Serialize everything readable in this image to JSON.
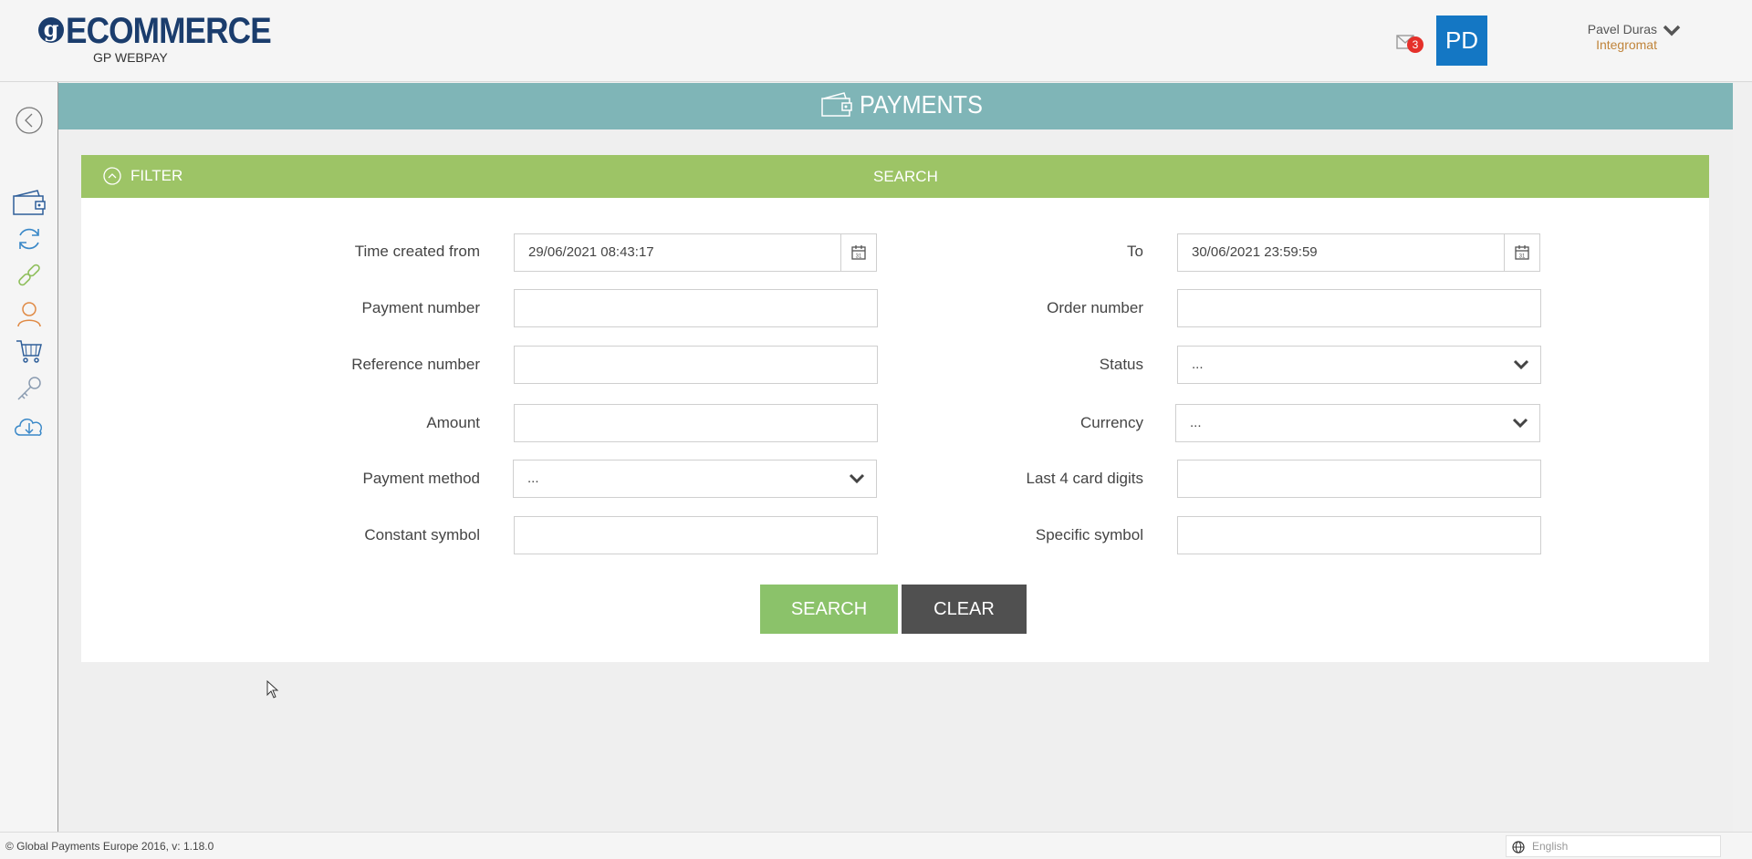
{
  "header": {
    "logo_letter": "g",
    "logo_title": "ECOMMERCE",
    "logo_subtitle": "GP WEBPAY",
    "messages_count": "3",
    "avatar_initials": "PD",
    "user_name": "Pavel Duras",
    "user_org": "Integromat"
  },
  "page": {
    "title": "PAYMENTS"
  },
  "filter": {
    "toggle_label": "FILTER",
    "center_label": "SEARCH"
  },
  "form": {
    "time_from_label": "Time created from",
    "time_from_value": "29/06/2021 08:43:17",
    "to_label": "To",
    "to_value": "30/06/2021 23:59:59",
    "payment_number_label": "Payment number",
    "order_number_label": "Order number",
    "reference_number_label": "Reference number",
    "status_label": "Status",
    "status_value": "...",
    "amount_label": "Amount",
    "currency_label": "Currency",
    "currency_value": "...",
    "payment_method_label": "Payment method",
    "payment_method_value": "...",
    "last4_label": "Last 4 card digits",
    "constant_symbol_label": "Constant symbol",
    "specific_symbol_label": "Specific symbol"
  },
  "buttons": {
    "search": "SEARCH",
    "clear": "CLEAR"
  },
  "footer": {
    "copyright": "© Global Payments Europe 2016, v: 1.18.0",
    "language_placeholder": "English"
  },
  "colors": {
    "brand_navy": "#1b3d6d",
    "banner_teal": "#7fb5b7",
    "filter_green": "#9dc466",
    "search_green": "#8bc26a",
    "clear_gray": "#505050",
    "avatar_blue": "#1477c4",
    "badge_red": "#e5302a",
    "org_orange": "#c0843a"
  },
  "icons": {
    "sidebar": [
      "back-circle-icon",
      "wallet-icon",
      "refresh-icon",
      "link-icon",
      "user-icon",
      "cart-icon",
      "key-icon",
      "cloud-download-icon"
    ]
  }
}
